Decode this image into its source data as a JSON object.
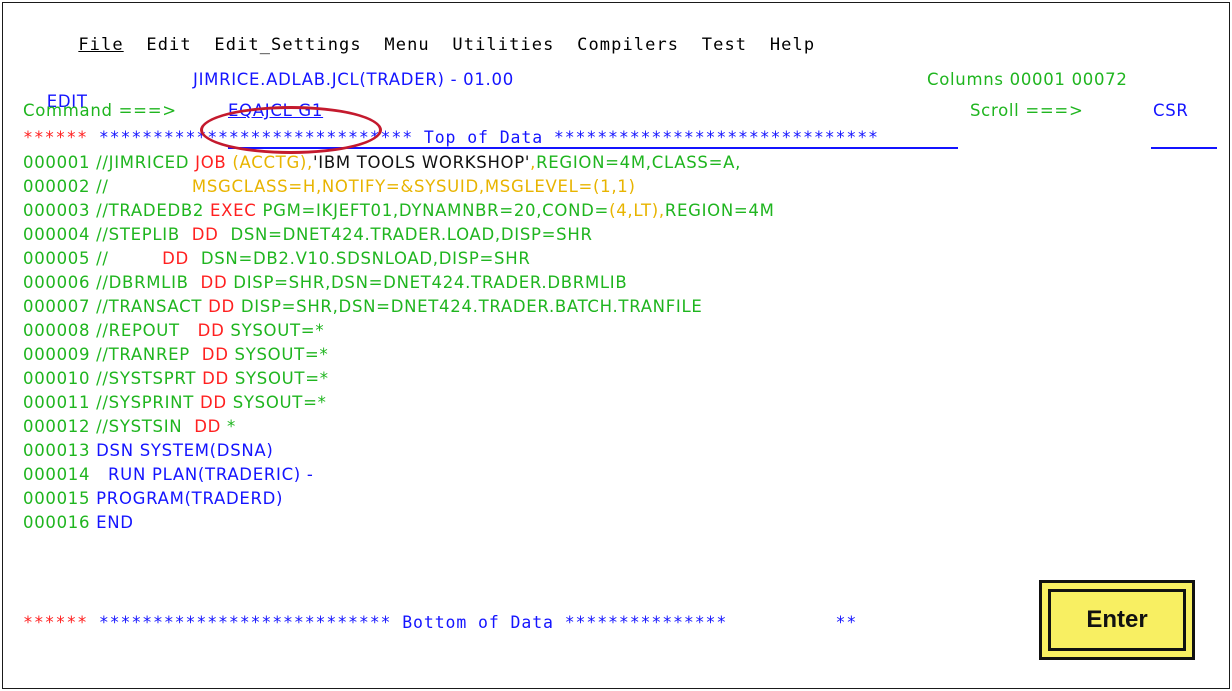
{
  "menu": [
    "File",
    "Edit",
    "Edit_Settings",
    "Menu",
    "Utilities",
    "Compilers",
    "Test",
    "Help"
  ],
  "header": {
    "mode": "EDIT",
    "dataset": "JIMRICE.ADLAB.JCL(TRADER) - 01.00",
    "columns": "Columns 00001 00072"
  },
  "command": {
    "label": "Command ===>",
    "value": "EQAJCL G1",
    "scroll_label": "Scroll ===>",
    "scroll_value": "CSR"
  },
  "top_banner": {
    "stars": "******",
    "text": " ***************************** Top of Data ******************************"
  },
  "lines": [
    {
      "num": "000001",
      "parts": [
        [
          "g",
          " //JIMRICED "
        ],
        [
          "r",
          "JOB"
        ],
        [
          "y",
          " (ACCTG),"
        ],
        [
          "k",
          "'IBM TOOLS WORKSHOP'"
        ],
        [
          "y",
          ","
        ],
        [
          "g",
          "REGION=4M,CLASS=A,"
        ]
      ]
    },
    {
      "num": "000002",
      "parts": [
        [
          "g",
          " //              "
        ],
        [
          "y",
          "MSGCLASS=H,NOTIFY=&SYSUID,MSGLEVEL=(1,1)"
        ]
      ]
    },
    {
      "num": "000003",
      "parts": [
        [
          "g",
          " //TRADEDB2 "
        ],
        [
          "r",
          "EXEC"
        ],
        [
          "g",
          " PGM=IKJEFT01,DYNAMNBR=20,COND="
        ],
        [
          "y",
          "(4,LT),"
        ],
        [
          "g",
          "REGION=4M"
        ]
      ]
    },
    {
      "num": "000004",
      "parts": [
        [
          "g",
          " //STEPLIB  "
        ],
        [
          "r",
          "DD"
        ],
        [
          "g",
          "  DSN=DNET424.TRADER.LOAD,DISP=SHR"
        ]
      ]
    },
    {
      "num": "000005",
      "parts": [
        [
          "g",
          " //         "
        ],
        [
          "r",
          "DD"
        ],
        [
          "g",
          "  DSN=DB2.V10.SDSNLOAD,DISP=SHR"
        ]
      ]
    },
    {
      "num": "000006",
      "parts": [
        [
          "g",
          " //DBRMLIB  "
        ],
        [
          "r",
          "DD"
        ],
        [
          "g",
          " DISP=SHR,DSN=DNET424.TRADER.DBRMLIB"
        ]
      ]
    },
    {
      "num": "000007",
      "parts": [
        [
          "g",
          " //TRANSACT "
        ],
        [
          "r",
          "DD"
        ],
        [
          "g",
          " DISP=SHR,DSN=DNET424.TRADER.BATCH.TRANFILE"
        ]
      ]
    },
    {
      "num": "000008",
      "parts": [
        [
          "g",
          " //REPOUT   "
        ],
        [
          "r",
          "DD"
        ],
        [
          "g",
          " SYSOUT=*"
        ]
      ]
    },
    {
      "num": "000009",
      "parts": [
        [
          "g",
          " //TRANREP  "
        ],
        [
          "r",
          "DD"
        ],
        [
          "g",
          " SYSOUT=*"
        ]
      ]
    },
    {
      "num": "000010",
      "parts": [
        [
          "g",
          " //SYSTSPRT "
        ],
        [
          "r",
          "DD"
        ],
        [
          "g",
          " SYSOUT=*"
        ]
      ]
    },
    {
      "num": "000011",
      "parts": [
        [
          "g",
          " //SYSPRINT "
        ],
        [
          "r",
          "DD"
        ],
        [
          "g",
          " SYSOUT=*"
        ]
      ]
    },
    {
      "num": "000012",
      "parts": [
        [
          "g",
          " //SYSTSIN  "
        ],
        [
          "r",
          "DD"
        ],
        [
          "g",
          " *"
        ]
      ]
    },
    {
      "num": "000013",
      "parts": [
        [
          "b",
          " DSN SYSTEM(DSNA)"
        ]
      ]
    },
    {
      "num": "000014",
      "parts": [
        [
          "b",
          "   RUN PLAN(TRADERIC) -"
        ]
      ]
    },
    {
      "num": "000015",
      "parts": [
        [
          "b",
          " PROGRAM(TRADERD)"
        ]
      ]
    },
    {
      "num": "000016",
      "parts": [
        [
          "b",
          " END"
        ]
      ]
    }
  ],
  "bottom_banner": {
    "stars": "******",
    "text": " *************************** Bottom of Data ***************          **"
  },
  "enter_button": "Enter",
  "colors": {
    "line_numbers": "#1fb51f",
    "keywords": "#ff2020",
    "params": "#e8b400",
    "text": "#1414ff",
    "annotation": "#c41a2e",
    "button_bg": "#f8ef62"
  }
}
